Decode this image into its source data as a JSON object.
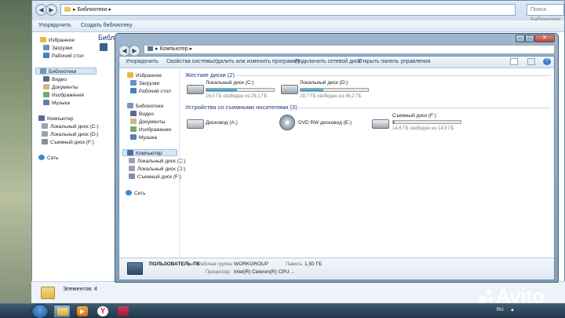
{
  "back_window": {
    "breadcrumb": "Библиотеки",
    "search_placeholder": "Поиск: Библиотеки",
    "toolbar": [
      "Упорядочить",
      "Создать библиотеку"
    ],
    "title_partial": "Библ",
    "sidebar": {
      "favorites_label": "Избранное",
      "favorites": [
        "Загрузки",
        "Рабочий стол"
      ],
      "libraries_label": "Библиотеки",
      "libraries": [
        "Видео",
        "Документы",
        "Изображения",
        "Музыка"
      ],
      "computer_label": "Компьютер",
      "computer": [
        "Локальный диск (C:)",
        "Локальный диск (D:)",
        "Съемный диск (F:)"
      ],
      "network_label": "Сеть"
    },
    "status": "Элементов: 4"
  },
  "front_window": {
    "breadcrumb": "Компьютер",
    "toolbar": [
      "Упорядочить",
      "Свойства системы",
      "Удалить или изменить программу",
      "Подключить сетевой диск",
      "Открыть панель управления"
    ],
    "sidebar": {
      "favorites_label": "Избранное",
      "favorites": [
        "Загрузки",
        "Рабочий стол"
      ],
      "libraries_label": "Библиотеки",
      "libraries": [
        "Видео",
        "Документы",
        "Изображения",
        "Музыка"
      ],
      "computer_label": "Компьютер",
      "computer": [
        "Локальный диск (C:)",
        "Локальный диск (D:)",
        "Съемный диск (F:)"
      ],
      "network_label": "Сеть"
    },
    "hard_disks": {
      "title": "Жесткие диски (2)",
      "drives": [
        {
          "name": "Локальный диск (C:)",
          "free": "16,0 ГБ свободно из 29,1 ГБ",
          "used_fraction": 0.45
        },
        {
          "name": "Локальный диск (D:)",
          "free": "29,7 ГБ свободно из 45,2 ГБ",
          "used_fraction": 0.34
        }
      ]
    },
    "removable": {
      "title": "Устройства со съемными носителями (3)",
      "drives": [
        {
          "name": "Дисковод (A:)"
        },
        {
          "name": "DVD RW дисковод (E:)"
        },
        {
          "name": "Съемный диск (F:)",
          "free": "14,6 ГБ свободно из 14,9 ГБ",
          "used_fraction": 0.02
        }
      ]
    },
    "details": {
      "pc_name": "ПОЛЬЗОВАТЕЛЬ-ПК",
      "workgroup_label": "Рабочая группа:",
      "workgroup": "WORKGROUP",
      "memory_label": "Память:",
      "memory": "1,50 ГБ",
      "cpu_label": "Процессор:",
      "cpu": "Intel(R) Celeron(R) CPU ..."
    }
  },
  "taskbar": {
    "lang": "RU"
  },
  "watermark": "Avito",
  "colors": {
    "accent": "#1e3287",
    "bar_fill": "#2897c9"
  }
}
